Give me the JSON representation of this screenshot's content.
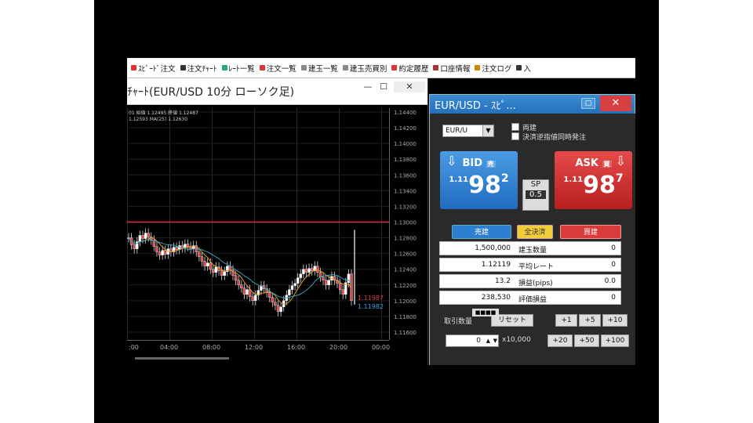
{
  "menu": {
    "items": [
      {
        "label": "ｽﾋﾟｰﾄﾞ注文",
        "icon": "speed-order-icon",
        "color": "#d33"
      },
      {
        "label": "注文ﾁｬｰﾄ",
        "icon": "order-chart-icon",
        "color": "#333"
      },
      {
        "label": "ﾚｰﾄ一覧",
        "icon": "rate-list-icon",
        "color": "#2a7"
      },
      {
        "label": "注文一覧",
        "icon": "order-list-icon",
        "color": "#d33"
      },
      {
        "label": "建玉一覧",
        "icon": "position-list-icon",
        "color": "#888"
      },
      {
        "label": "建玉売買別",
        "icon": "position-side-icon",
        "color": "#888"
      },
      {
        "label": "約定履歴",
        "icon": "execution-history-icon",
        "color": "#d33"
      },
      {
        "label": "口座情報",
        "icon": "account-info-icon",
        "color": "#a33"
      },
      {
        "label": "注文ログ",
        "icon": "order-log-icon",
        "color": "#c80"
      },
      {
        "label": "入",
        "icon": "deposit-icon",
        "color": "#333"
      }
    ]
  },
  "chart_window": {
    "title": "ﾁｬｰﾄ(EUR/USD 10分 ローソク足)",
    "legend_line1": "01 始値 1.12495 終値 1.12487",
    "legend_line2": "1.12593 MA(25) 1.12630",
    "min_btn": "—",
    "max_btn": "☐",
    "close_btn": "✕"
  },
  "chart_data": {
    "type": "candlestick",
    "symbol": "EUR/USD",
    "timeframe": "10分",
    "ylim": [
      1.115,
      1.1445
    ],
    "yticks": [
      1.144,
      1.142,
      1.14,
      1.138,
      1.136,
      1.134,
      1.132,
      1.13,
      1.128,
      1.126,
      1.124,
      1.122,
      1.12,
      1.118,
      1.116
    ],
    "ytick_labels": [
      "1.14400",
      "1.14200",
      "1.14000",
      "1.13800",
      "1.13600",
      "1.13400",
      "1.13200",
      "1.13000",
      "1.12800",
      "1.12600",
      "1.12400",
      "1.12200",
      "1.12000",
      "1.11800",
      "1.11600"
    ],
    "xtick_labels": [
      ":00",
      "04:00",
      "08:00",
      "12:00",
      "16:00",
      "20:00",
      "00:00"
    ],
    "hline": {
      "value": 1.13,
      "color": "#e0304a"
    },
    "ask_label": "1.11987",
    "bid_label": "1.11982",
    "close_series": [
      1.128,
      1.1271,
      1.1266,
      1.1275,
      1.1283,
      1.1279,
      1.1286,
      1.1281,
      1.1277,
      1.1269,
      1.1262,
      1.1258,
      1.1264,
      1.1259,
      1.1266,
      1.1262,
      1.1268,
      1.1265,
      1.127,
      1.1267,
      1.1272,
      1.1269,
      1.1266,
      1.127,
      1.1262,
      1.1256,
      1.125,
      1.1244,
      1.1248,
      1.124,
      1.1236,
      1.1243,
      1.1238,
      1.1232,
      1.1237,
      1.1244,
      1.1239,
      1.1232,
      1.1226,
      1.122,
      1.1216,
      1.1208,
      1.1214,
      1.1205,
      1.12,
      1.1207,
      1.1213,
      1.1219,
      1.1215,
      1.121,
      1.1204,
      1.1198,
      1.1194,
      1.1186,
      1.1192,
      1.12,
      1.1207,
      1.1214,
      1.1219,
      1.1222,
      1.1229,
      1.1234,
      1.124,
      1.1236,
      1.1241,
      1.1238,
      1.1244,
      1.1236,
      1.123,
      1.1226,
      1.122,
      1.1226,
      1.1231,
      1.1226,
      1.1222,
      1.1214,
      1.1208,
      1.1223,
      1.1234,
      1.12
    ]
  },
  "order_panel": {
    "title": "EUR/USD - ｽﾋﾟ...",
    "min_btn": "□",
    "close_btn": "✕",
    "pair": "EUR/U",
    "check1": "両建",
    "check2": "決済逆指値同時発注",
    "bid": {
      "label": "BID",
      "small": "1.11",
      "big": "98",
      "end": "2",
      "tag": "売"
    },
    "ask": {
      "label": "ASK",
      "small": "1.11",
      "big": "98",
      "end": "7",
      "tag": "買"
    },
    "sp_label": "SP",
    "sp_value": "0.5",
    "sell_btn": "売建",
    "settle_btn": "全決済",
    "buy_btn": "買建",
    "rows": [
      {
        "v1": "1,500,000",
        "label": "建玉数量",
        "v2": "0"
      },
      {
        "v1": "1.12119",
        "label": "平均レート",
        "v2": "0"
      },
      {
        "v1": "13.2",
        "label": "損益(pips)",
        "v2": "0.0"
      },
      {
        "v1": "238,530",
        "label": "評価損益",
        "v2": "0"
      }
    ],
    "qty_label": "取引数量",
    "reset_btn": "リセット",
    "plus1": "+1",
    "plus5": "+5",
    "plus10": "+10",
    "plus20": "+20",
    "plus50": "+50",
    "plus100": "+100",
    "qty_value": "0",
    "qty_unit": "x10,000"
  },
  "taskbar": {
    "label": "■■■■"
  }
}
